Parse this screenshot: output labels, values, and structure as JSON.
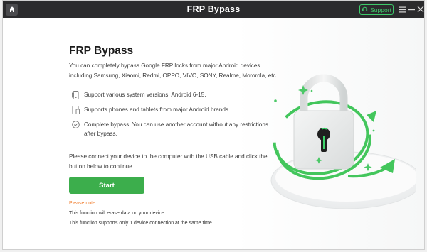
{
  "titlebar": {
    "title": "FRP Bypass",
    "support_label": "Support",
    "icons": [
      "home-icon",
      "headset-icon",
      "menu-icon",
      "minimize-icon",
      "close-icon"
    ]
  },
  "main": {
    "heading": "FRP Bypass",
    "intro": "You can completely bypass Google FRP locks from major Android devices including Samsung, Xiaomi, Redmi, OPPO, VIVO, SONY, Realme, Motorola, etc.",
    "features": [
      {
        "icon": "phone-versions-icon",
        "text": "Support various system versions: Android 6-15."
      },
      {
        "icon": "phone-tablet-icon",
        "text": "Supports phones and tablets from major Android brands."
      },
      {
        "icon": "check-circle-icon",
        "text": "Complete bypass: You can use another account without any restrictions after bypass."
      }
    ],
    "instruction": "Please connect your device to the computer with the USB cable and click the button below to continue.",
    "start_label": "Start",
    "note_title": "Please note:",
    "notes": [
      "This function will erase data on your device.",
      "This function supports only 1 device connection at the same time."
    ]
  },
  "colors": {
    "titlebar_bg": "#2b2b2d",
    "accent_green": "#3cae4c",
    "support_green": "#3ec96a",
    "note_orange": "#f07d2e"
  },
  "illustration": {
    "icon": "padlock-illustration-icon"
  }
}
